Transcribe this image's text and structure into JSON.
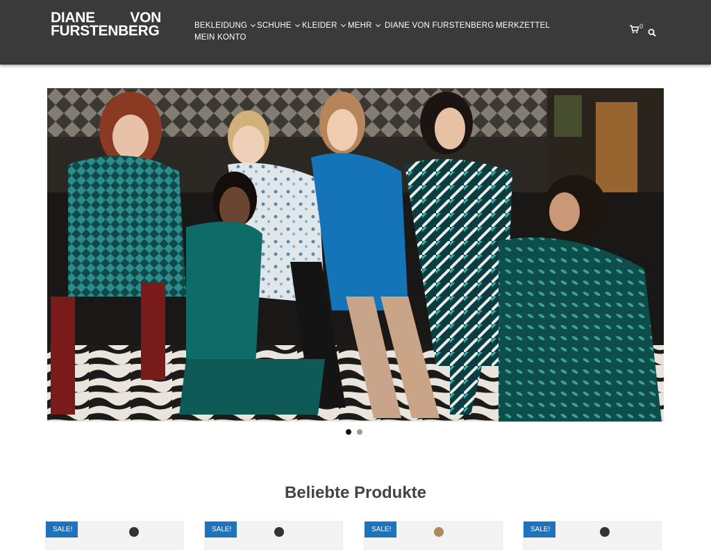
{
  "brand": {
    "line1a": "DIANE",
    "line1b": "VON",
    "line2": "FURSTENBERG"
  },
  "nav": {
    "items": [
      {
        "label": "BEKLEIDUNG",
        "dropdown": true
      },
      {
        "label": "SCHUHE",
        "dropdown": true
      },
      {
        "label": "KLEIDER",
        "dropdown": true
      },
      {
        "label": "MEHR",
        "dropdown": true
      },
      {
        "label": "DIANE VON FURSTENBERG",
        "dropdown": false
      },
      {
        "label": "MERKZETTEL",
        "dropdown": false
      },
      {
        "label": "MEIN KONTO",
        "dropdown": false
      }
    ]
  },
  "cart": {
    "count": "0",
    "icon": "shopping-cart-icon"
  },
  "search": {
    "icon": "search-icon"
  },
  "hero": {
    "slide_index": 1,
    "slide_total": 2
  },
  "section": {
    "title": "Beliebte Produkte"
  },
  "products": [
    {
      "badge": "SALE!"
    },
    {
      "badge": "SALE!"
    },
    {
      "badge": "SALE!"
    },
    {
      "badge": "SALE!"
    }
  ],
  "colors": {
    "header_bg": "#3a3a3a",
    "sale_badge": "#1e73be",
    "dot_active": "#111111"
  }
}
